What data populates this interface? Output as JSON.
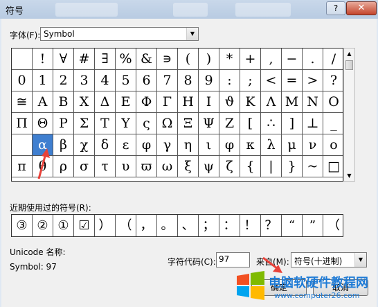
{
  "window": {
    "title": "符号",
    "help_label": "?",
    "close_label": "✕"
  },
  "font": {
    "label": "字体(F):",
    "value": "Symbol"
  },
  "grid_rows": [
    [
      "",
      "!",
      "∀",
      "#",
      "∃",
      "%",
      "&",
      "∍",
      "(",
      ")",
      "*",
      "+",
      ",",
      "−",
      ".",
      "/"
    ],
    [
      "0",
      "1",
      "2",
      "3",
      "4",
      "5",
      "6",
      "7",
      "8",
      "9",
      ":",
      ";",
      "<",
      "=",
      ">",
      "?"
    ],
    [
      "≅",
      "Α",
      "Β",
      "Χ",
      "Δ",
      "Ε",
      "Φ",
      "Γ",
      "Η",
      "Ι",
      "ϑ",
      "Κ",
      "Λ",
      "Μ",
      "Ν",
      "Ο"
    ],
    [
      "Π",
      "Θ",
      "Ρ",
      "Σ",
      "Τ",
      "Υ",
      "ς",
      "Ω",
      "Ξ",
      "Ψ",
      "Ζ",
      "[",
      "∴",
      "]",
      "⊥",
      "_"
    ],
    [
      "",
      "α",
      "β",
      "χ",
      "δ",
      "ε",
      "φ",
      "γ",
      "η",
      "ι",
      "φ",
      "κ",
      "λ",
      "μ",
      "ν",
      "ο"
    ],
    [
      "π",
      "θ",
      "ρ",
      "σ",
      "τ",
      "υ",
      "ϖ",
      "ω",
      "ξ",
      "ψ",
      "ζ",
      "{",
      "|",
      "}",
      "~",
      "□"
    ]
  ],
  "selected": {
    "row": 4,
    "col": 1
  },
  "recent": {
    "label": "近期使用过的符号(R):",
    "items": [
      "③",
      "②",
      "①",
      "☑",
      "）",
      "（",
      "，",
      "。",
      "、",
      "；",
      "：",
      "！",
      "？",
      "“",
      "”",
      "（"
    ]
  },
  "unicode_label": "Unicode 名称:",
  "symbol_info": "Symbol: 97",
  "code": {
    "label": "字符代码(C):",
    "value": "97"
  },
  "from": {
    "label": "来自(M):",
    "value": "符号(十进制)"
  },
  "buttons": {
    "ok": "确定",
    "cancel": "取消"
  },
  "watermark": {
    "title": "电脑软硬件教程网",
    "url": "www.computer26.com"
  },
  "colors": {
    "selection": "#3f7fd0",
    "arrow": "#e8423a",
    "watermark": "#1e7bd6"
  }
}
